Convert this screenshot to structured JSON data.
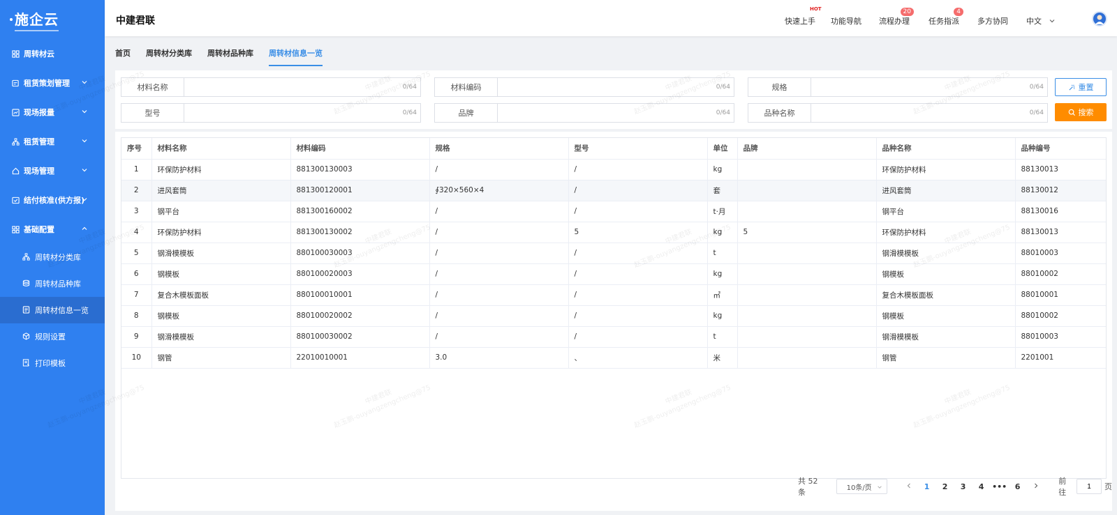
{
  "logo": {
    "text": "施企云"
  },
  "sidebar": {
    "items": [
      {
        "label": "周转材云",
        "icon": "grid-icon"
      },
      {
        "label": "租赁策划管理",
        "icon": "plan-icon"
      },
      {
        "label": "现场报量",
        "icon": "report-icon"
      },
      {
        "label": "租赁管理",
        "icon": "org-icon"
      },
      {
        "label": "现场管理",
        "icon": "home-icon"
      },
      {
        "label": "结付核准(供方报)",
        "icon": "check-icon"
      },
      {
        "label": "基础配置",
        "icon": "grid-icon"
      }
    ],
    "sub_items": [
      {
        "label": "周转材分类库",
        "icon": "org-icon"
      },
      {
        "label": "周转材品种库",
        "icon": "stack-icon"
      },
      {
        "label": "周转材信息一览",
        "icon": "list-icon"
      },
      {
        "label": "规则设置",
        "icon": "cube-icon"
      },
      {
        "label": "打印模板",
        "icon": "print-icon"
      }
    ]
  },
  "header": {
    "brand": "中建君联",
    "links": [
      {
        "label": "快速上手",
        "hot": "HOT"
      },
      {
        "label": "功能导航"
      },
      {
        "label": "流程办理",
        "badge": "20"
      },
      {
        "label": "任务指派",
        "badge": "4"
      },
      {
        "label": "多方协同"
      }
    ],
    "language": "中文"
  },
  "tabs": [
    "首页",
    "周转材分类库",
    "周转材品种库",
    "周转材信息一览"
  ],
  "filters": {
    "row1": [
      {
        "label": "材料名称",
        "count": "0/64"
      },
      {
        "label": "材料编码",
        "count": "0/64"
      },
      {
        "label": "规格",
        "count": "0/64"
      }
    ],
    "row2": [
      {
        "label": "型号",
        "count": "0/64"
      },
      {
        "label": "品牌",
        "count": "0/64"
      },
      {
        "label": "品种名称",
        "count": "0/64"
      }
    ],
    "reset_label": "重置",
    "search_label": "搜索"
  },
  "table": {
    "headers": [
      "序号",
      "材料名称",
      "材料编码",
      "规格",
      "型号",
      "单位",
      "品牌",
      "品种名称",
      "品种编号"
    ],
    "rows": [
      [
        "1",
        "环保防护材料",
        "881300130003",
        "/",
        "/",
        "kg",
        "",
        "环保防护材料",
        "88130013"
      ],
      [
        "2",
        "进风套筒",
        "881300120001",
        "∮320×560×4",
        "/",
        "套",
        "",
        "进风套筒",
        "88130012"
      ],
      [
        "3",
        "钢平台",
        "881300160002",
        "/",
        "/",
        "t·月",
        "",
        "钢平台",
        "88130016"
      ],
      [
        "4",
        "环保防护材料",
        "881300130002",
        "/",
        "5",
        "kg",
        "5",
        "环保防护材料",
        "88130013"
      ],
      [
        "5",
        "钢滑模模板",
        "880100030003",
        "/",
        "/",
        "t",
        "",
        "钢滑模模板",
        "88010003"
      ],
      [
        "6",
        "钢模板",
        "880100020003",
        "/",
        "/",
        "kg",
        "",
        "钢模板",
        "88010002"
      ],
      [
        "7",
        "复合木模板面板",
        "880100010001",
        "/",
        "/",
        "㎡",
        "",
        "复合木模板面板",
        "88010001"
      ],
      [
        "8",
        "钢模板",
        "880100020002",
        "/",
        "/",
        "kg",
        "",
        "钢模板",
        "88010002"
      ],
      [
        "9",
        "钢滑模模板",
        "880100030002",
        "/",
        "/",
        "t",
        "",
        "钢滑模模板",
        "88010003"
      ],
      [
        "10",
        "钢管",
        "22010010001",
        "3.0",
        "、",
        "米",
        "",
        "钢管",
        "2201001"
      ]
    ]
  },
  "pagination": {
    "total": "共 52 条",
    "page_size": "10条/页",
    "pages": [
      "1",
      "2",
      "3",
      "4",
      "•••",
      "6"
    ],
    "goto_prefix": "前往",
    "goto_value": "1",
    "goto_suffix": "页"
  },
  "watermark": {
    "line1": "中建君联",
    "line2": "赵玉鹏-ouyangzengcheng@75"
  }
}
